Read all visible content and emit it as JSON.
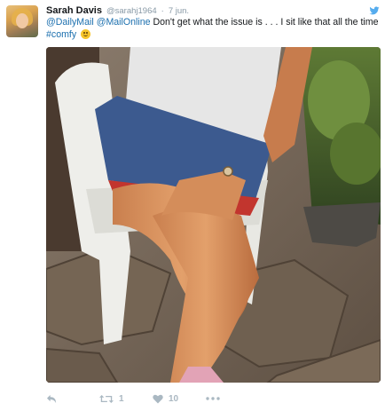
{
  "tweet": {
    "author": {
      "display_name": "Sarah Davis",
      "handle": "@sarahj1964",
      "separator": "·",
      "date": "7 jun."
    },
    "text": {
      "mention_1": "@DailyMail",
      "mention_2": "@MailOnline",
      "body": "Don't get what the issue is . . . I sit like that all the time",
      "hashtag": "#comfy"
    },
    "icons": {
      "avatar": "avatar-photo",
      "logo": "twitter-bird-icon",
      "emoji": "smiling-face-emoji",
      "reply": "reply-icon",
      "retweet": "retweet-icon",
      "like": "heart-icon",
      "more": "more-dots-icon"
    },
    "actions": {
      "retweet_count": "1",
      "like_count": "10"
    },
    "colors": {
      "link": "#1b6fae",
      "muted": "#8899a6",
      "action_icon": "#aab8c2",
      "twitter_blue": "#55acee"
    }
  }
}
